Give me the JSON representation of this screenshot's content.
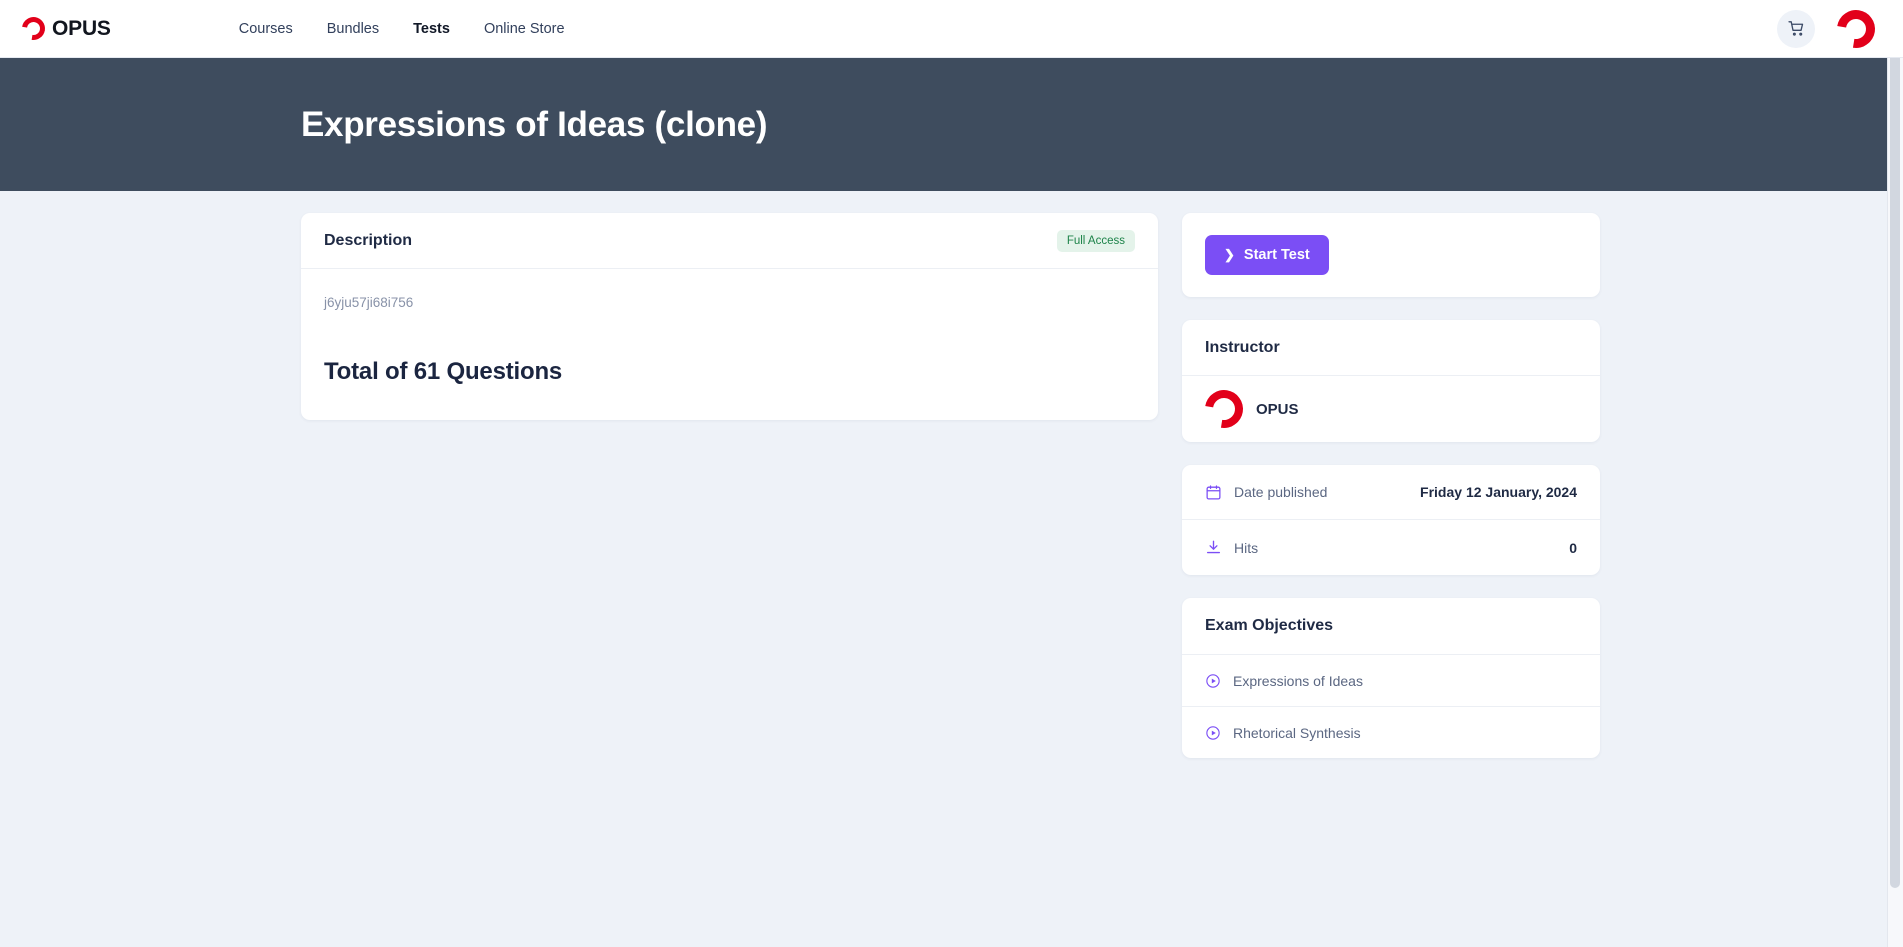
{
  "nav": {
    "brand": "OPUS",
    "brand_logo_icon": "opus-ring-logo",
    "links": [
      {
        "label": "Courses",
        "active": false
      },
      {
        "label": "Bundles",
        "active": false
      },
      {
        "label": "Tests",
        "active": true
      },
      {
        "label": "Online Store",
        "active": false
      }
    ],
    "cart_icon": "shopping-cart-icon",
    "account_icon": "opus-ring-logo"
  },
  "hero": {
    "title": "Expressions of Ideas (clone)"
  },
  "description_card": {
    "title": "Description",
    "badge": "Full Access",
    "body_text": "j6yju57ji68i756",
    "total_heading": "Total of 61 Questions"
  },
  "start_test": {
    "label": "Start Test",
    "chevron_icon": "chevron-right-icon"
  },
  "instructor_card": {
    "title": "Instructor",
    "name": "OPUS",
    "avatar_icon": "opus-ring-logo"
  },
  "meta_card": {
    "rows": [
      {
        "icon": "calendar-icon",
        "label": "Date published",
        "value": "Friday 12 January, 2024"
      },
      {
        "icon": "download-icon",
        "label": "Hits",
        "value": "0"
      }
    ]
  },
  "objectives_card": {
    "title": "Exam Objectives",
    "items": [
      {
        "icon": "play-circle-icon",
        "label": "Expressions of Ideas"
      },
      {
        "icon": "play-circle-icon",
        "label": "Rhetorical Synthesis"
      }
    ]
  },
  "colors": {
    "brand_red": "#e2001a",
    "hero_bg": "#3e4c5e",
    "page_bg": "#eef2f8",
    "accent_purple": "#7b4ef5",
    "badge_green_text": "#1d8349",
    "badge_green_bg": "#e4f3ea"
  }
}
